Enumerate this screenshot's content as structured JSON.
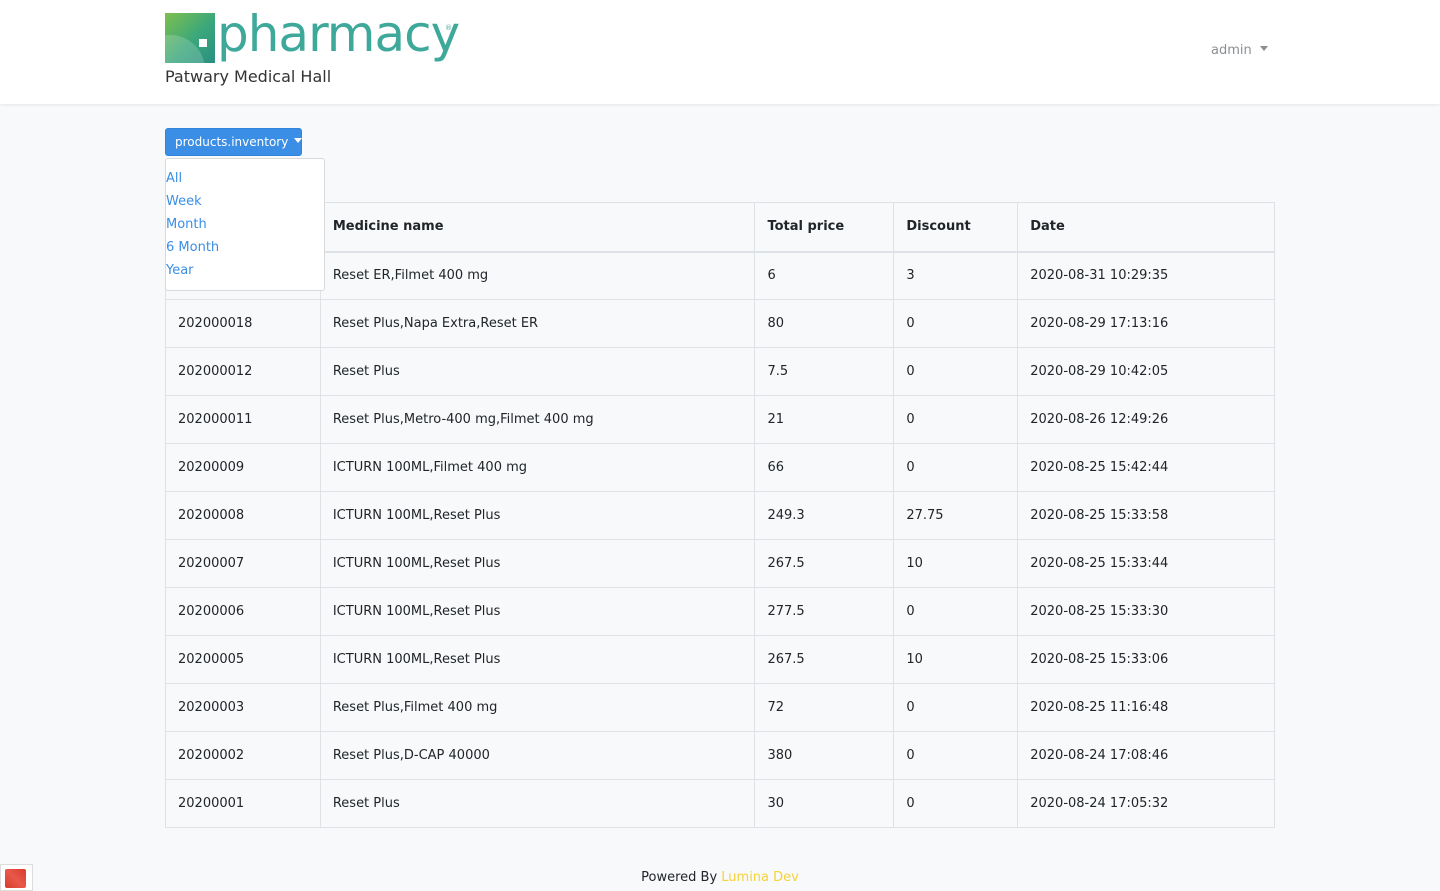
{
  "header": {
    "logo_text": "pharmacy",
    "logo_reg": "®",
    "shop_name": "Patwary Medical Hall",
    "user_label": "admin"
  },
  "filter": {
    "button_label": "products.inventory",
    "options": [
      "All",
      "Week",
      "Month",
      "6 Month",
      "Year"
    ]
  },
  "table": {
    "columns": [
      "",
      "Medicine name",
      "Total price",
      "Discount",
      "Date"
    ],
    "rows": [
      [
        "",
        "Reset ER,Filmet 400 mg",
        "6",
        "3",
        "2020-08-31 10:29:35"
      ],
      [
        "202000018",
        "Reset Plus,Napa Extra,Reset ER",
        "80",
        "0",
        "2020-08-29 17:13:16"
      ],
      [
        "202000012",
        "Reset Plus",
        "7.5",
        "0",
        "2020-08-29 10:42:05"
      ],
      [
        "202000011",
        "Reset Plus,Metro-400 mg,Filmet 400 mg",
        "21",
        "0",
        "2020-08-26 12:49:26"
      ],
      [
        "20200009",
        "ICTURN 100ML,Filmet 400 mg",
        "66",
        "0",
        "2020-08-25 15:42:44"
      ],
      [
        "20200008",
        "ICTURN 100ML,Reset Plus",
        "249.3",
        "27.75",
        "2020-08-25 15:33:58"
      ],
      [
        "20200007",
        "ICTURN 100ML,Reset Plus",
        "267.5",
        "10",
        "2020-08-25 15:33:44"
      ],
      [
        "20200006",
        "ICTURN 100ML,Reset Plus",
        "277.5",
        "0",
        "2020-08-25 15:33:30"
      ],
      [
        "20200005",
        "ICTURN 100ML,Reset Plus",
        "267.5",
        "10",
        "2020-08-25 15:33:06"
      ],
      [
        "20200003",
        "Reset Plus,Filmet 400 mg",
        "72",
        "0",
        "2020-08-25 11:16:48"
      ],
      [
        "20200002",
        "Reset Plus,D-CAP 40000",
        "380",
        "0",
        "2020-08-24 17:08:46"
      ],
      [
        "20200001",
        "Reset Plus",
        "30",
        "0",
        "2020-08-24 17:05:32"
      ]
    ]
  },
  "footer": {
    "prefix": "Powered By",
    "dev_name": "Lumina Dev"
  },
  "colors": {
    "accent": "#3a8ee6",
    "brand": "#3ea89a",
    "footer_dev": "#f5d33a"
  }
}
